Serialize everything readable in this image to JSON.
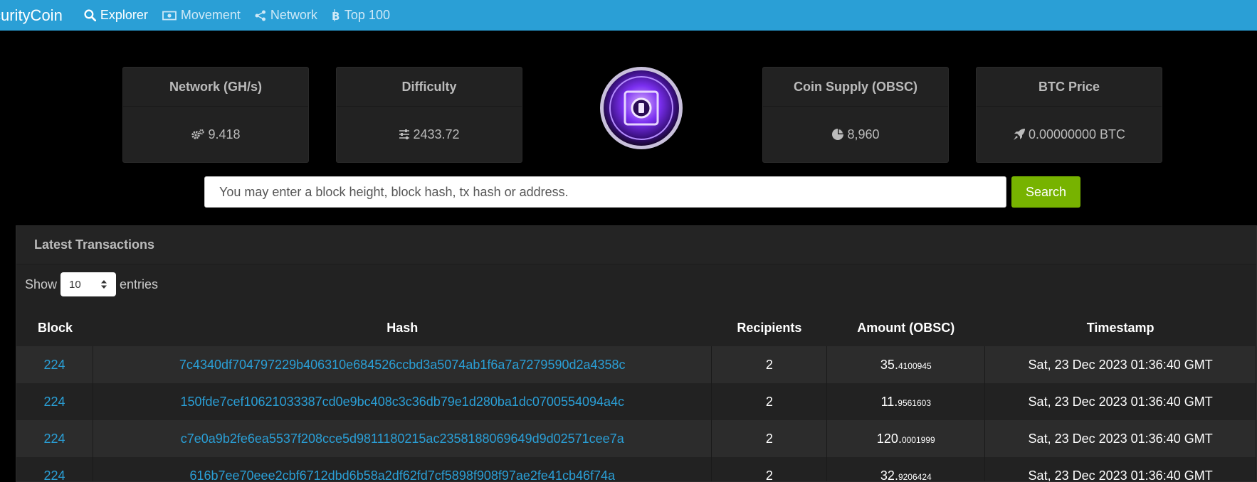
{
  "colors": {
    "nav": "#2a9fd6",
    "search_button": "#77b300",
    "link": "#2a9fd6",
    "background": "#000000"
  },
  "nav": {
    "brand": "curityCoin",
    "items": [
      {
        "label": "Explorer",
        "icon": "search-icon",
        "active": true
      },
      {
        "label": "Movement",
        "icon": "money-icon"
      },
      {
        "label": "Network",
        "icon": "share-icon"
      },
      {
        "label": "Top 100",
        "icon": "bitcoin-icon"
      }
    ]
  },
  "stats": [
    {
      "title": "Network (GH/s)",
      "value": "9.418",
      "icon": "gears-icon"
    },
    {
      "title": "Difficulty",
      "value": "2433.72",
      "icon": "sliders-icon"
    },
    {
      "title": "Coin Supply (OBSC)",
      "value": "8,960",
      "icon": "pie-chart-icon"
    },
    {
      "title": "BTC Price",
      "value": "0.00000000 BTC",
      "icon": "rocket-icon"
    }
  ],
  "search": {
    "placeholder": "You may enter a block height, block hash, tx hash or address.",
    "button": "Search"
  },
  "transactions": {
    "title": "Latest Transactions",
    "show_label": "Show",
    "entries_value": "10",
    "entries_label": "entries",
    "columns": [
      "Block",
      "Hash",
      "Recipients",
      "Amount (OBSC)",
      "Timestamp"
    ],
    "rows": [
      {
        "block": "224",
        "hash": "7c4340df704797229b406310e684526ccbd3a5074ab1f6a7a7279590d2a4358c",
        "recipients": "2",
        "amount_int": "35.",
        "amount_dec": "4100945",
        "timestamp": "Sat, 23 Dec 2023 01:36:40 GMT"
      },
      {
        "block": "224",
        "hash": "150fde7cef10621033387cd0e9bc408c3c36db79e1d280ba1dc0700554094a4c",
        "recipients": "2",
        "amount_int": "11.",
        "amount_dec": "9561603",
        "timestamp": "Sat, 23 Dec 2023 01:36:40 GMT"
      },
      {
        "block": "224",
        "hash": "c7e0a9b2fe6ea5537f208cce5d9811180215ac2358188069649d9d02571cee7a",
        "recipients": "2",
        "amount_int": "120.",
        "amount_dec": "0001999",
        "timestamp": "Sat, 23 Dec 2023 01:36:40 GMT"
      },
      {
        "block": "224",
        "hash": "616b7ee70eee2cbf6712dbd6b58a2df62fd7cf5898f908f97ae2fe41cb46f74a",
        "recipients": "2",
        "amount_int": "32.",
        "amount_dec": "9206424",
        "timestamp": "Sat, 23 Dec 2023 01:36:40 GMT"
      }
    ]
  }
}
